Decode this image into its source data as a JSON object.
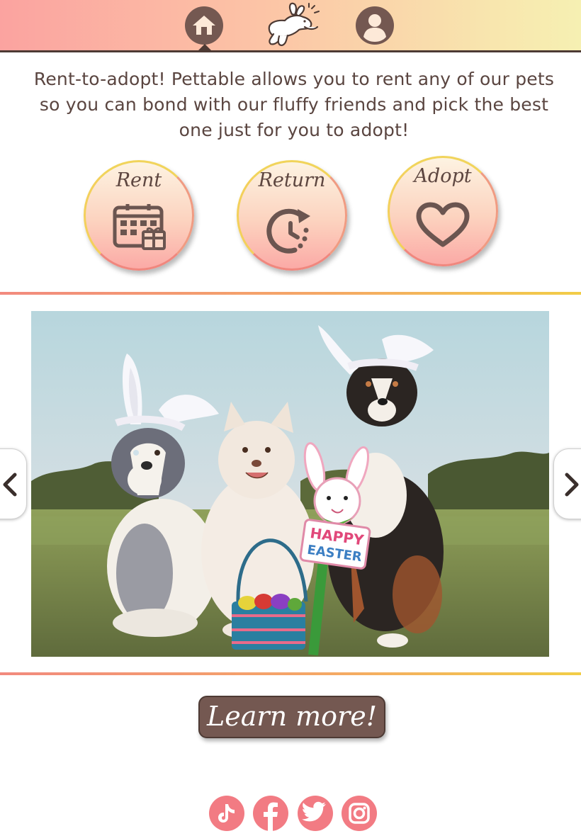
{
  "header": {
    "home_icon": "home-icon",
    "logo_icon": "leaping-bunny-logo",
    "profile_icon": "user-profile-icon",
    "active_nav": "home"
  },
  "intro": {
    "text": "Rent-to-adopt! Pettable allows you to rent any of our pets so you can bond with our fluffy friends and pick the best one just for you to adopt!"
  },
  "actions": [
    {
      "label": "Rent",
      "icon": "calendar-gift-icon"
    },
    {
      "label": "Return",
      "icon": "clock-return-icon"
    },
    {
      "label": "Adopt",
      "icon": "heart-icon"
    }
  ],
  "carousel": {
    "sign_line1": "HAPPY",
    "sign_line2": "EASTER",
    "prev_icon": "chevron-left-icon",
    "next_icon": "chevron-right-icon"
  },
  "cta": {
    "label": "Learn more!"
  },
  "socials": [
    {
      "name": "tiktok",
      "icon": "tiktok-icon"
    },
    {
      "name": "facebook",
      "icon": "facebook-icon"
    },
    {
      "name": "twitter",
      "icon": "twitter-icon"
    },
    {
      "name": "instagram",
      "icon": "instagram-icon"
    }
  ],
  "colors": {
    "brown": "#4d3a34",
    "button_brown": "#745851",
    "coral": "#f27b83",
    "gold": "#f2cd47",
    "peach": "#fcc4a6"
  }
}
